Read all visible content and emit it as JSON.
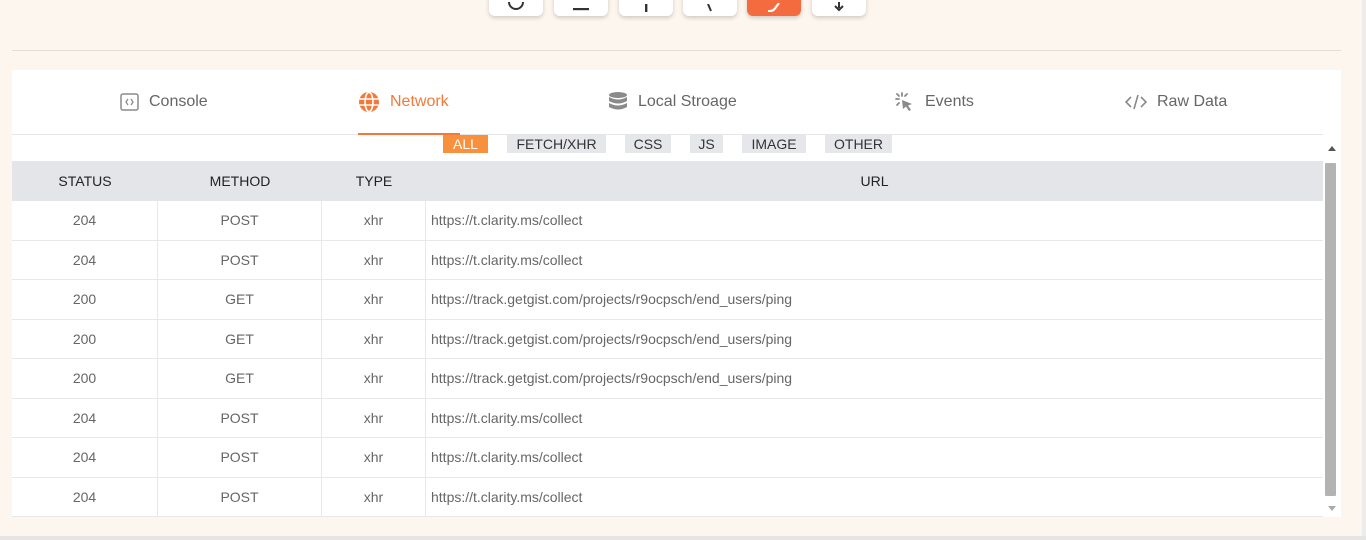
{
  "tabs": [
    {
      "label": "Console",
      "icon": "console-icon",
      "active": false
    },
    {
      "label": "Network",
      "icon": "globe-icon",
      "active": true
    },
    {
      "label": "Local Stroage",
      "icon": "database-icon",
      "active": false
    },
    {
      "label": "Events",
      "icon": "click-icon",
      "active": false
    },
    {
      "label": "Raw Data",
      "icon": "code-icon",
      "active": false
    }
  ],
  "filters": [
    "ALL",
    "FETCH/XHR",
    "CSS",
    "JS",
    "IMAGE",
    "OTHER"
  ],
  "active_filter": "ALL",
  "table": {
    "headers": {
      "status": "STATUS",
      "method": "METHOD",
      "type": "TYPE",
      "url": "URL"
    },
    "rows": [
      {
        "status": "204",
        "method": "POST",
        "type": "xhr",
        "url": "https://t.clarity.ms/collect"
      },
      {
        "status": "204",
        "method": "POST",
        "type": "xhr",
        "url": "https://t.clarity.ms/collect"
      },
      {
        "status": "200",
        "method": "GET",
        "type": "xhr",
        "url": "https://track.getgist.com/projects/r9ocpsch/end_users/ping"
      },
      {
        "status": "200",
        "method": "GET",
        "type": "xhr",
        "url": "https://track.getgist.com/projects/r9ocpsch/end_users/ping"
      },
      {
        "status": "200",
        "method": "GET",
        "type": "xhr",
        "url": "https://track.getgist.com/projects/r9ocpsch/end_users/ping"
      },
      {
        "status": "204",
        "method": "POST",
        "type": "xhr",
        "url": "https://t.clarity.ms/collect"
      },
      {
        "status": "204",
        "method": "POST",
        "type": "xhr",
        "url": "https://t.clarity.ms/collect"
      },
      {
        "status": "204",
        "method": "POST",
        "type": "xhr",
        "url": "https://t.clarity.ms/collect"
      }
    ]
  },
  "colors": {
    "accent": "#f3793a",
    "active_chip": "#f7913d",
    "background": "#fdf6ee"
  }
}
